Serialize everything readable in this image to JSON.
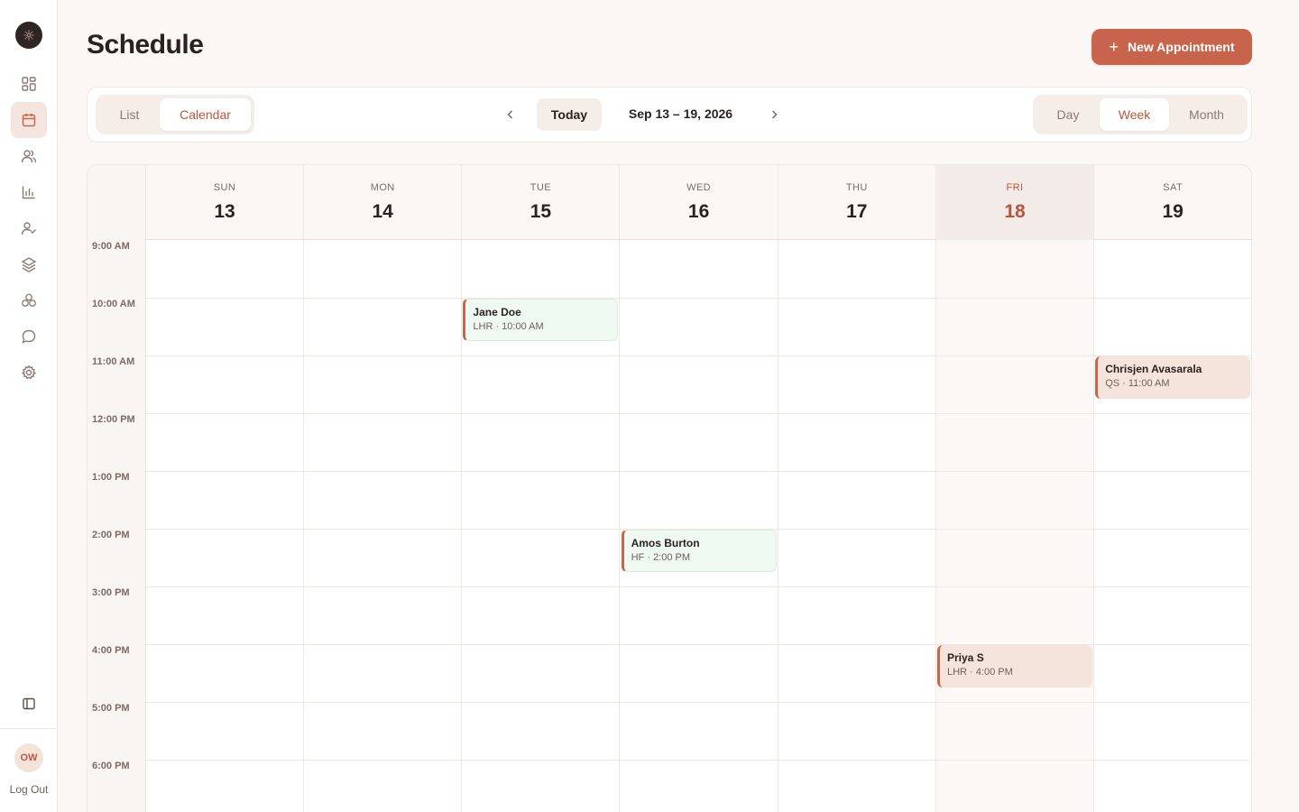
{
  "sidebar": {
    "items": [
      {
        "name": "dashboard",
        "icon": "grid-icon",
        "active": false
      },
      {
        "name": "schedule",
        "icon": "calendar-icon",
        "active": true
      },
      {
        "name": "clients",
        "icon": "users-icon",
        "active": false
      },
      {
        "name": "reports",
        "icon": "bar-chart-icon",
        "active": false
      },
      {
        "name": "staff",
        "icon": "user-check-icon",
        "active": false
      },
      {
        "name": "services",
        "icon": "layers-icon",
        "active": false
      },
      {
        "name": "packages",
        "icon": "boxes-icon",
        "active": false
      },
      {
        "name": "messages",
        "icon": "chat-icon",
        "active": false
      },
      {
        "name": "settings",
        "icon": "gear-icon",
        "active": false
      }
    ],
    "collapse_icon": "sidebar-toggle-icon",
    "user_initials": "OW",
    "logout_label": "Log Out"
  },
  "header": {
    "title": "Schedule",
    "new_button_label": "New Appointment"
  },
  "toolbar": {
    "view_modes": [
      "List",
      "Calendar"
    ],
    "active_view": "Calendar",
    "today_label": "Today",
    "range_label": "Sep 13 – 19, 2026",
    "ranges": [
      "Day",
      "Week",
      "Month"
    ],
    "active_range": "Week"
  },
  "calendar": {
    "days": [
      {
        "dow": "SUN",
        "num": "13",
        "today": false
      },
      {
        "dow": "MON",
        "num": "14",
        "today": false
      },
      {
        "dow": "TUE",
        "num": "15",
        "today": false
      },
      {
        "dow": "WED",
        "num": "16",
        "today": false
      },
      {
        "dow": "THU",
        "num": "17",
        "today": false
      },
      {
        "dow": "FRI",
        "num": "18",
        "today": true
      },
      {
        "dow": "SAT",
        "num": "19",
        "today": false
      }
    ],
    "hours": [
      "9:00 AM",
      "10:00 AM",
      "11:00 AM",
      "12:00 PM",
      "1:00 PM",
      "2:00 PM",
      "3:00 PM",
      "4:00 PM",
      "5:00 PM",
      "6:00 PM"
    ],
    "events": [
      {
        "name": "Jane Doe",
        "detail": "LHR · 10:00 AM",
        "day_index": 2,
        "hour_index": 1,
        "style": "green"
      },
      {
        "name": "Chrisjen Avasarala",
        "detail": "QS · 11:00 AM",
        "day_index": 6,
        "hour_index": 2,
        "style": "peach"
      },
      {
        "name": "Amos Burton",
        "detail": "HF · 2:00 PM",
        "day_index": 3,
        "hour_index": 5,
        "style": "green"
      },
      {
        "name": "Priya S",
        "detail": "LHR · 4:00 PM",
        "day_index": 5,
        "hour_index": 7,
        "style": "peach"
      }
    ]
  },
  "colors": {
    "accent": "#c8644c",
    "accent_text": "#b9553e",
    "event_green": "#eef9f1",
    "event_peach": "#f4e4dc"
  }
}
